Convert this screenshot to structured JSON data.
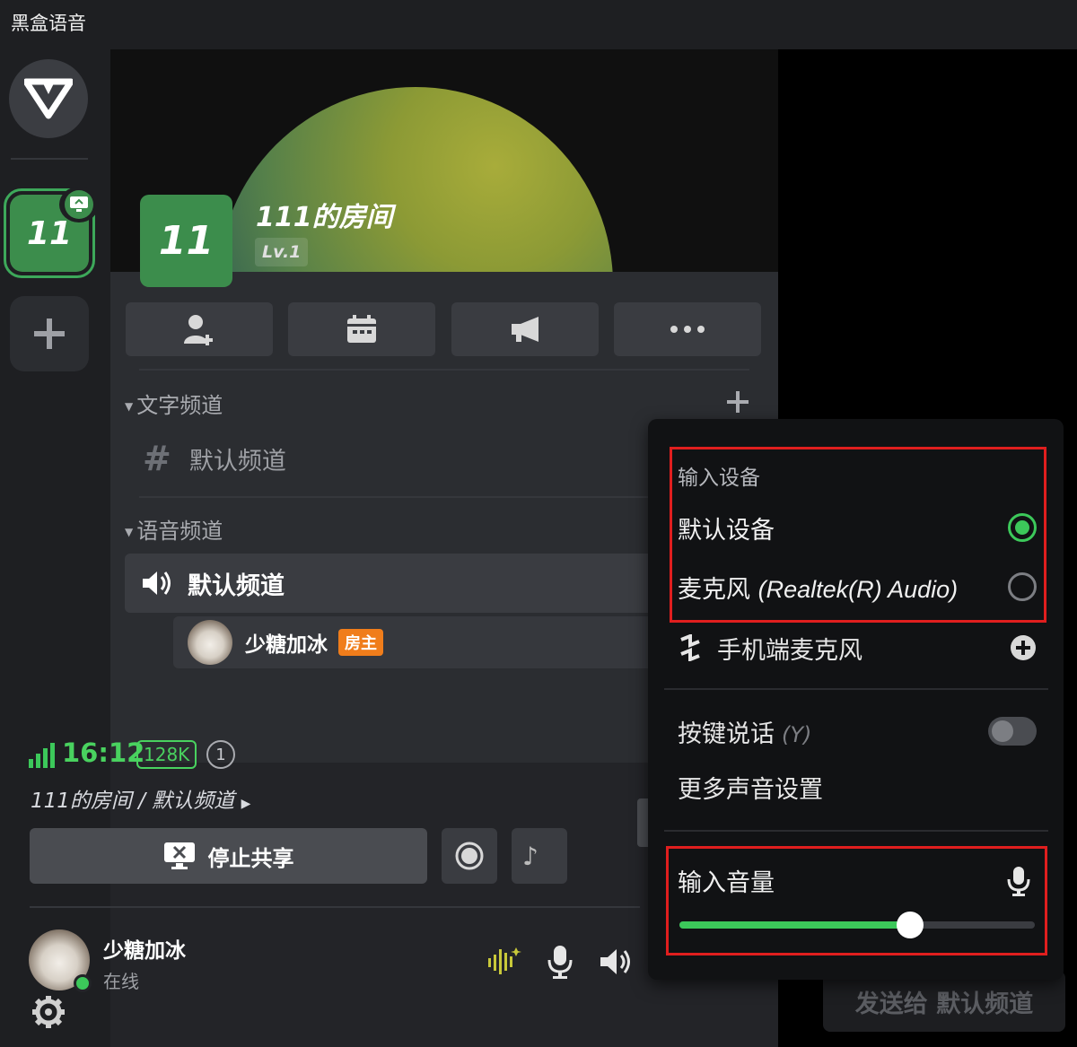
{
  "app": {
    "title": "黑盒语音"
  },
  "server": {
    "label": "11",
    "name": "111的房间",
    "level": "Lv.1"
  },
  "sections": {
    "text": {
      "title": "文字频道",
      "channel": "默认频道"
    },
    "voice": {
      "title": "语音频道",
      "channel": "默认频道"
    }
  },
  "member": {
    "name": "少糖加冰",
    "badge": "房主"
  },
  "voice_status": {
    "duration": "16:12",
    "bitrate": "128K",
    "listeners": "1",
    "path": "111的房间 / 默认频道",
    "stop_share": "停止共享"
  },
  "self": {
    "name": "少糖加冰",
    "status": "在线"
  },
  "chat": {
    "placeholder": "发送给 默认频道"
  },
  "popup": {
    "heading": "输入设备",
    "devices": [
      {
        "label": "默认设备",
        "selected": true
      },
      {
        "label_main": "麦克风 ",
        "label_detail": "(Realtek(R) Audio)",
        "selected": false
      }
    ],
    "phone_mic": "手机端麦克风",
    "push_to_talk": "按键说话",
    "push_to_talk_key": "(Y)",
    "push_to_talk_enabled": false,
    "more_sound": "更多声音设置",
    "volume_label": "输入音量",
    "volume_level": 0.65
  },
  "colors": {
    "accent": "#3cc85a",
    "server": "#3c8d4c",
    "badge": "#f07d1b",
    "highlight": "#e01e1e"
  }
}
